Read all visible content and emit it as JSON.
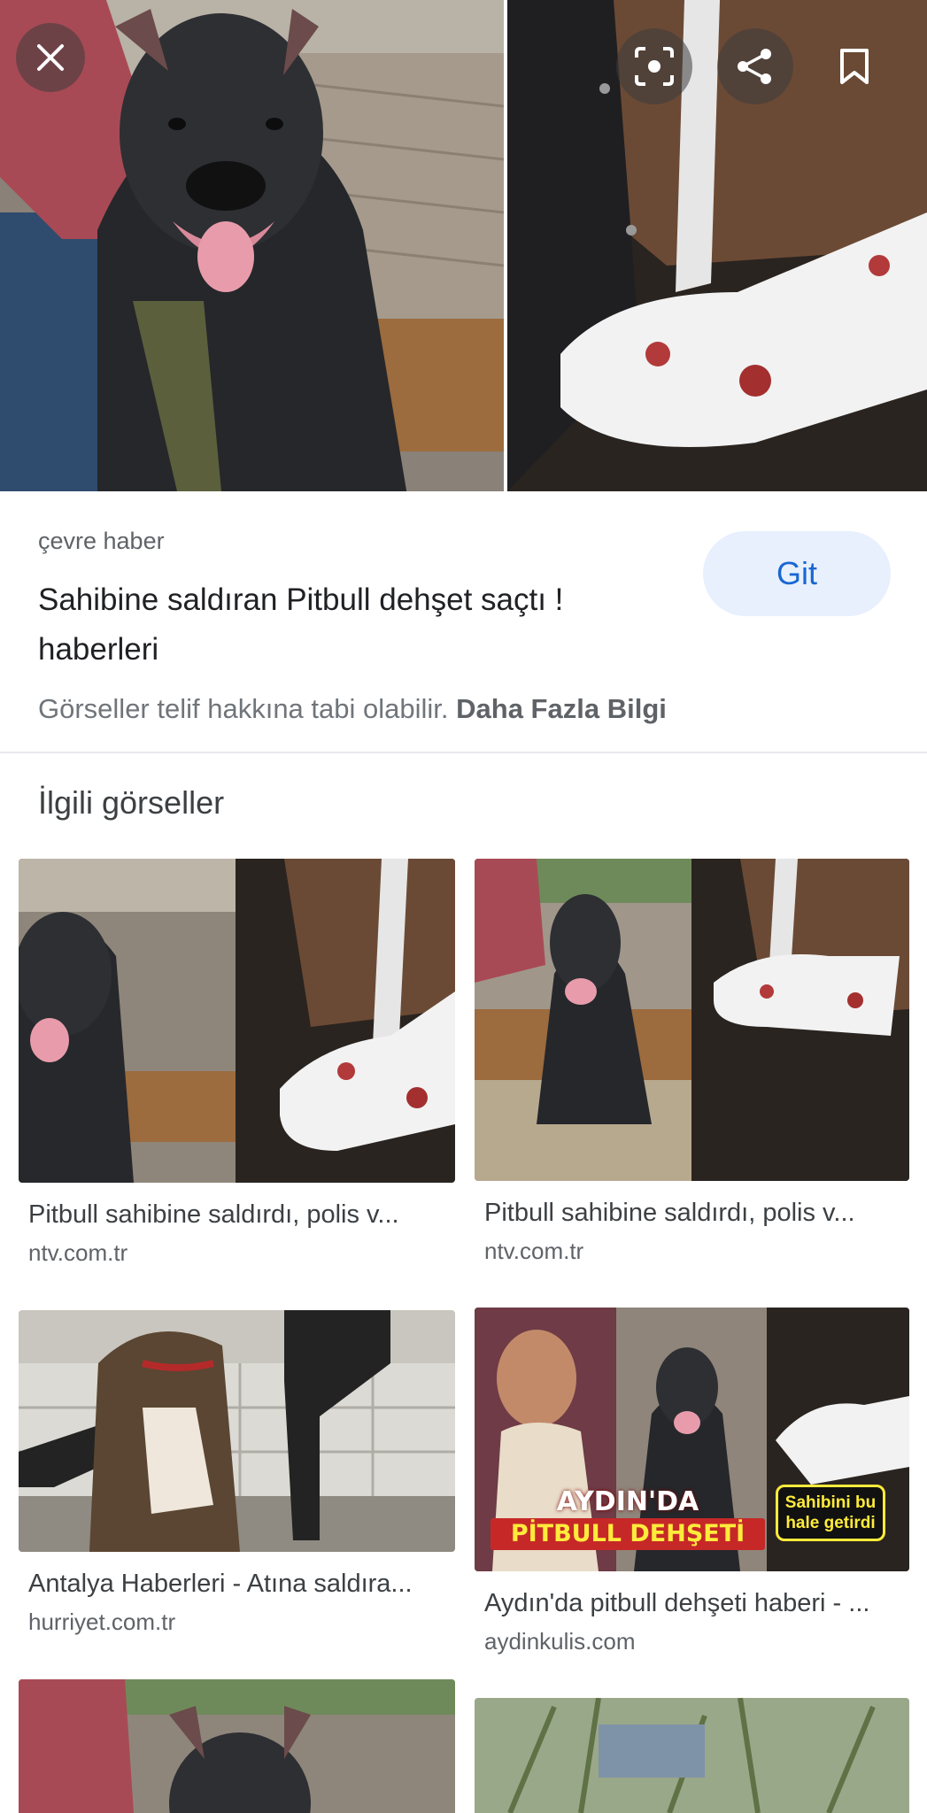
{
  "hero": {
    "close_icon": "close-icon",
    "lens_icon": "lens-icon",
    "share_icon": "share-icon",
    "bookmark_icon": "bookmark-icon"
  },
  "result": {
    "source": "çevre haber",
    "title": "Sahibine saldıran Pitbull dehşet saçtı ! haberleri",
    "go_label": "Git",
    "copyright_text": "Görseller telif hakkına tabi olabilir.",
    "learn_more": "Daha Fazla Bilgi"
  },
  "related": {
    "heading": "İlgili görseller",
    "items": [
      {
        "caption": "Pitbull sahibine saldırdı, polis v...",
        "domain": "ntv.com.tr"
      },
      {
        "caption": "Pitbull sahibine saldırdı, polis v...",
        "domain": "ntv.com.tr"
      },
      {
        "caption": "Antalya Haberleri - Atına saldıra...",
        "domain": "hurriyet.com.tr"
      },
      {
        "caption": "Aydın'da pitbull dehşeti haberi - ...",
        "domain": "aydinkulis.com"
      }
    ],
    "overlay": {
      "headline_1": "AYDIN'DA",
      "headline_2": "PİTBULL DEHŞETİ",
      "badge": "Sahibini bu hale getirdi"
    }
  },
  "colors": {
    "accent": "#1967d2",
    "button_bg": "#e8f0fe",
    "overlay_red": "#c62828",
    "overlay_yellow": "#ffeb3b"
  }
}
